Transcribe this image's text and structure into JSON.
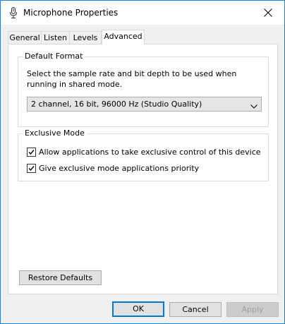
{
  "window": {
    "title": "Microphone Properties",
    "icon": "microphone-icon",
    "accent_color": "#1883d7"
  },
  "tabs": [
    {
      "label": "General",
      "active": false
    },
    {
      "label": "Listen",
      "active": false
    },
    {
      "label": "Levels",
      "active": false
    },
    {
      "label": "Advanced",
      "active": true
    }
  ],
  "default_format": {
    "title": "Default Format",
    "description": "Select the sample rate and bit depth to be used when running in shared mode.",
    "selected": "2 channel, 16 bit, 96000 Hz (Studio Quality)"
  },
  "exclusive_mode": {
    "title": "Exclusive Mode",
    "options": [
      {
        "label": "Allow applications to take exclusive control of this device",
        "checked": true
      },
      {
        "label": "Give exclusive mode applications priority",
        "checked": true
      }
    ]
  },
  "buttons": {
    "restore_defaults": "Restore Defaults",
    "ok": "OK",
    "cancel": "Cancel",
    "apply": "Apply"
  }
}
